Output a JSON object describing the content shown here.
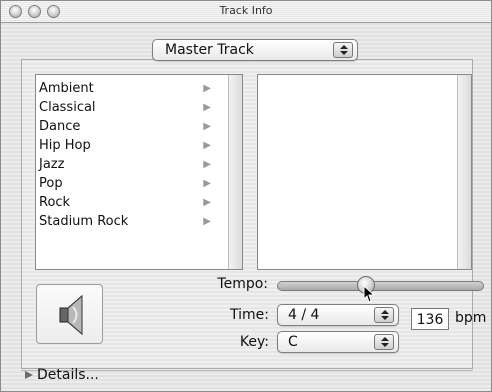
{
  "window": {
    "title": "Track Info"
  },
  "master_popup": {
    "label": "Master Track"
  },
  "genres": [
    "Ambient",
    "Classical",
    "Dance",
    "Hip Hop",
    "Jazz",
    "Pop",
    "Rock",
    "Stadium Rock"
  ],
  "tempo": {
    "label": "Tempo:",
    "level": 0.42
  },
  "time": {
    "label": "Time:",
    "value": "4 / 4"
  },
  "bpm": {
    "value": "136",
    "unit": "bpm"
  },
  "key": {
    "label": "Key:",
    "value": "C"
  },
  "details": {
    "label": "Details..."
  },
  "icons": {
    "traffic": [
      "close-icon",
      "minimize-icon",
      "zoom-icon"
    ],
    "speaker": "speaker-icon",
    "genre_arrow": "chevron-right-icon",
    "stepper": "up-down-stepper-icon"
  }
}
